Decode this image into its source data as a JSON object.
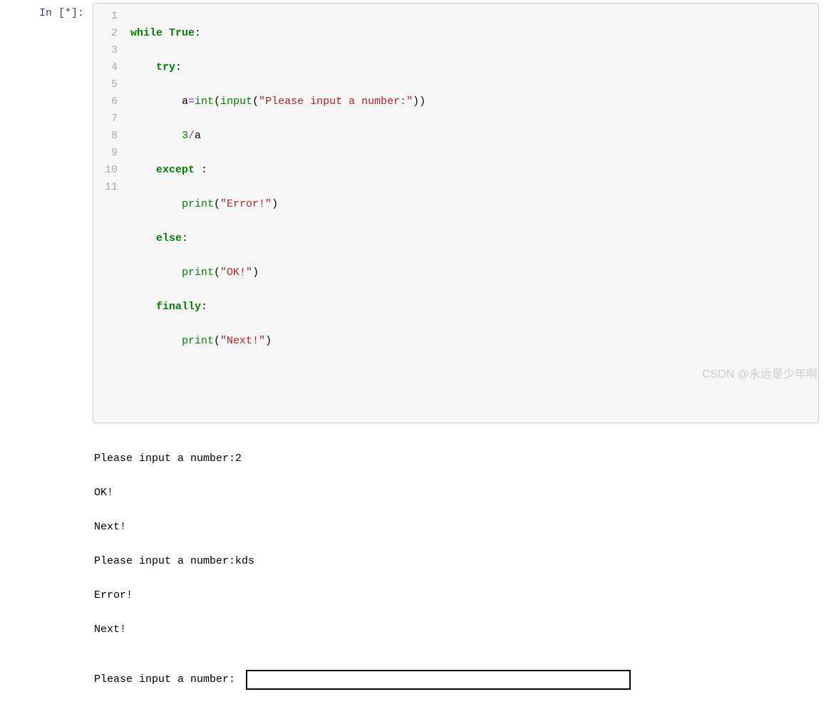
{
  "cell": {
    "prompt_prefix": "In ",
    "prompt_status": "[*]:",
    "line_numbers": [
      "1",
      "2",
      "3",
      "4",
      "5",
      "6",
      "7",
      "8",
      "9",
      "10",
      "11"
    ],
    "code": {
      "line1": {
        "kw1": "while",
        "sp1": " ",
        "kw2": "True",
        "colon": ":"
      },
      "line2": {
        "indent": "    ",
        "kw": "try",
        "colon": ":"
      },
      "line3": {
        "indent": "        ",
        "var": "a",
        "eq": "=",
        "fn": "int",
        "lp": "(",
        "fn2": "input",
        "lp2": "(",
        "str": "\"Please input a number:\"",
        "rp2": ")",
        "rp": ")"
      },
      "line4": {
        "indent": "        ",
        "num": "3",
        "op": "/",
        "var": "a"
      },
      "line5": {
        "indent": "    ",
        "kw": "except",
        "sp": " ",
        "colon": ":"
      },
      "line6": {
        "indent": "        ",
        "fn": "print",
        "lp": "(",
        "str": "\"Error!\"",
        "rp": ")"
      },
      "line7": {
        "indent": "    ",
        "kw": "else",
        "colon": ":"
      },
      "line8": {
        "indent": "        ",
        "fn": "print",
        "lp": "(",
        "str": "\"OK!\"",
        "rp": ")"
      },
      "line9": {
        "indent": "    ",
        "kw": "finally",
        "colon": ":"
      },
      "line10": {
        "indent": "        ",
        "fn": "print",
        "lp": "(",
        "str": "\"Next!\"",
        "rp": ")"
      }
    }
  },
  "output": {
    "line1": "Please input a number:2",
    "line2": "OK!",
    "line3": "Next!",
    "line4": "Please input a number:kds",
    "line5": "Error!",
    "line6": "Next!"
  },
  "stdin": {
    "label": "Please input a number: ",
    "value": ""
  },
  "watermark": "CSDN @永远是少年啊"
}
